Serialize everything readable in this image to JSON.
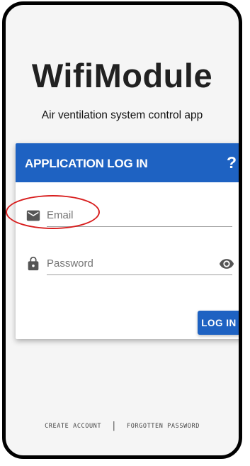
{
  "app": {
    "title": "WifiModule",
    "subtitle": "Air ventilation system control app"
  },
  "login_card": {
    "header_title": "APPLICATION LOG IN",
    "help_label": "?",
    "email_placeholder": "Email",
    "email_value": "",
    "email_icon": "mail-icon",
    "password_placeholder": "Password",
    "password_value": "",
    "password_icon": "lock-icon",
    "visibility_icon": "eye-icon",
    "login_label": "LOG IN"
  },
  "footer": {
    "create_account": "CREATE ACCOUNT",
    "separator": "|",
    "forgotten_password": "FORGOTTEN PASSWORD"
  },
  "colors": {
    "primary": "#1e62c2",
    "highlight": "#d81e1e",
    "background": "#f5f5f5"
  }
}
